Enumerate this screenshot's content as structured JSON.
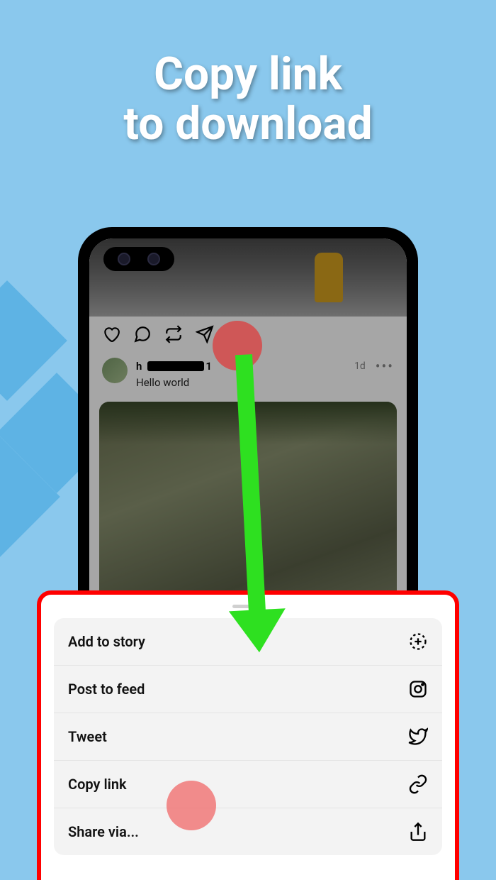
{
  "headline": {
    "line1": "Copy link",
    "line2": "to download"
  },
  "post": {
    "username_prefix": "h",
    "username_suffix": "1",
    "timestamp": "1d",
    "caption": "Hello world"
  },
  "sheet": {
    "items": [
      {
        "label": "Add to story",
        "icon": "add-story-icon"
      },
      {
        "label": "Post to feed",
        "icon": "instagram-icon"
      },
      {
        "label": "Tweet",
        "icon": "twitter-icon"
      },
      {
        "label": "Copy link",
        "icon": "link-icon"
      },
      {
        "label": "Share via...",
        "icon": "share-icon"
      }
    ]
  }
}
